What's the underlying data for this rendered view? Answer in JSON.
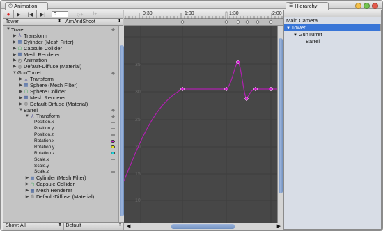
{
  "window": {
    "tabs": {
      "animation": {
        "label": "Animation",
        "icon": "clock-icon"
      },
      "hierarchy": {
        "label": "Hierarchy",
        "icon": "list-icon"
      }
    },
    "traffic_lights": [
      "#f4c04a",
      "#73c34f",
      "#e2584a"
    ]
  },
  "toolbar": {
    "record_icon": "●",
    "play_icon": "▶",
    "prev_key_icon": "|◀",
    "next_key_icon": "▶|",
    "frame_value": "0",
    "add_key_icon": "◇+",
    "add_event_icon": "ǀ+"
  },
  "selectors": {
    "object": "Tower",
    "clip": "AimAndShoot",
    "show": "Show: All",
    "wrap_mode": "Default"
  },
  "property_tree": [
    {
      "label": "Tower",
      "indent": 0,
      "tri": "▼",
      "icon": "",
      "bold": true,
      "mark": "diamond"
    },
    {
      "label": "Transform",
      "indent": 1,
      "tri": "▶",
      "icon": "transform",
      "mark": ""
    },
    {
      "label": "Cylinder (Mesh Filter)",
      "indent": 1,
      "tri": "▶",
      "icon": "meshfilter",
      "mark": ""
    },
    {
      "label": "Capsule Collider",
      "indent": 1,
      "tri": "▶",
      "icon": "collider",
      "mark": ""
    },
    {
      "label": "Mesh Renderer",
      "indent": 1,
      "tri": "▶",
      "icon": "renderer",
      "mark": ""
    },
    {
      "label": "Animation",
      "indent": 1,
      "tri": "▶",
      "icon": "animation",
      "mark": ""
    },
    {
      "label": "Default-Diffuse (Material)",
      "indent": 1,
      "tri": "▶",
      "icon": "material",
      "mark": ""
    },
    {
      "label": "GunTurret",
      "indent": 1,
      "tri": "▼",
      "icon": "",
      "mark": "diamond"
    },
    {
      "label": "Transform",
      "indent": 2,
      "tri": "▶",
      "icon": "transform",
      "mark": ""
    },
    {
      "label": "Sphere (Mesh Filter)",
      "indent": 2,
      "tri": "▶",
      "icon": "meshfilter",
      "mark": ""
    },
    {
      "label": "Sphere Collider",
      "indent": 2,
      "tri": "▶",
      "icon": "collider",
      "mark": ""
    },
    {
      "label": "Mesh Renderer",
      "indent": 2,
      "tri": "▶",
      "icon": "renderer",
      "mark": ""
    },
    {
      "label": "Default-Diffuse (Material)",
      "indent": 2,
      "tri": "▶",
      "icon": "material",
      "mark": ""
    },
    {
      "label": "Barrel",
      "indent": 2,
      "tri": "▼",
      "icon": "",
      "mark": "diamond"
    },
    {
      "label": "Transform",
      "indent": 3,
      "tri": "▼",
      "icon": "transform",
      "mark": "diamond"
    },
    {
      "label": "Position.x",
      "indent": 4,
      "tri": "",
      "icon": "",
      "mark": "dash",
      "small": true
    },
    {
      "label": "Position.y",
      "indent": 4,
      "tri": "",
      "icon": "",
      "mark": "dash",
      "small": true
    },
    {
      "label": "Position.z",
      "indent": 4,
      "tri": "",
      "icon": "",
      "mark": "dash",
      "small": true
    },
    {
      "label": "Rotation.x",
      "indent": 4,
      "tri": "",
      "icon": "",
      "mark": "dot",
      "color": "#d020d0",
      "small": true
    },
    {
      "label": "Rotation.y",
      "indent": 4,
      "tri": "",
      "icon": "",
      "mark": "dot",
      "color": "#e8e820",
      "small": true
    },
    {
      "label": "Rotation.z",
      "indent": 4,
      "tri": "",
      "icon": "",
      "mark": "dot",
      "color": "#20d8e0",
      "small": true
    },
    {
      "label": "Scale.x",
      "indent": 4,
      "tri": "",
      "icon": "",
      "mark": "dash",
      "small": true
    },
    {
      "label": "Scale.y",
      "indent": 4,
      "tri": "",
      "icon": "",
      "mark": "dash",
      "small": true
    },
    {
      "label": "Scale.z",
      "indent": 4,
      "tri": "",
      "icon": "",
      "mark": "dash",
      "small": true
    },
    {
      "label": "Cylinder (Mesh Filter)",
      "indent": 3,
      "tri": "▶",
      "icon": "meshfilter",
      "mark": ""
    },
    {
      "label": "Capsule Collider",
      "indent": 3,
      "tri": "▶",
      "icon": "collider",
      "mark": ""
    },
    {
      "label": "Mesh Renderer",
      "indent": 3,
      "tri": "▶",
      "icon": "renderer",
      "mark": ""
    },
    {
      "label": "Default-Diffuse (Material)",
      "indent": 3,
      "tri": "▶",
      "icon": "material",
      "mark": ""
    }
  ],
  "timeline": {
    "labels": [
      "0:30",
      "1:00",
      "1:30",
      "2:00"
    ],
    "playhead_label": "1:30"
  },
  "graph": {
    "y_labels": [
      "35",
      "30",
      "25",
      "20",
      "15",
      "10"
    ],
    "curve_color": "#b020b0",
    "key_color": "#d020d0"
  },
  "hierarchy": {
    "items": [
      {
        "label": "Main Camera",
        "indent": 0,
        "selected": false
      },
      {
        "label": "Tower",
        "indent": 0,
        "selected": true,
        "tri": "▼"
      },
      {
        "label": "GunTurret",
        "indent": 1,
        "selected": false,
        "tri": "▼"
      },
      {
        "label": "Barrel",
        "indent": 2,
        "selected": false
      }
    ]
  }
}
